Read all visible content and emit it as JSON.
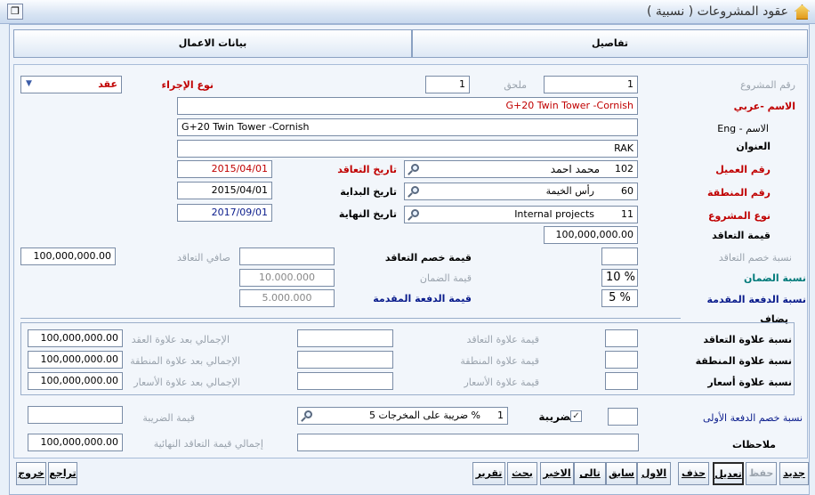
{
  "window": {
    "title": "عقود المشروعات ( نسبية )",
    "app_icon": "home-icon",
    "restore_icon": "restore-icon"
  },
  "tabs": [
    "تفاصيل",
    "بيانات الاعمال"
  ],
  "labels": {
    "project_no": "رقم المشروع",
    "annex": "ملحق",
    "procedure_type": "نوع الإجراء",
    "name_ar": "الاسم -عربي",
    "name_en": "الاسم - Eng",
    "address": "العنوان",
    "client_no": "رقم العميل",
    "contract_date": "تاريخ التعاقد",
    "region_no": "رقم المنطقة",
    "start_date": "تاريخ البداية",
    "project_type": "نوع المشروع",
    "end_date": "تاريخ النهاية",
    "contract_value": "قيمة التعاقد",
    "discount_pct": "نسبة خصم التعاقد",
    "discount_value": "قيمة خصم التعاقد",
    "net_contract": "صافي التعاقد",
    "guarantee_pct": "نسبة الضمان",
    "guarantee_value": "قيمة الضمان",
    "advance_pct": "نسبة الدفعة المقدمة",
    "advance_value": "قيمة الدفعة المقدمة",
    "added": "يضاف",
    "contract_bonus_pct": "نسبة علاوة التعاقد",
    "contract_bonus_value": "قيمة علاوة التعاقد",
    "total_after_contract_bonus": "الإجمالي بعد علاوة العقد",
    "region_bonus_pct": "نسبة علاوة المنطقة",
    "region_bonus_value": "قيمة علاوة المنطقة",
    "total_after_region_bonus": "الإجمالي بعد علاوة المنطقة",
    "price_bonus_pct": "نسبة علاوة أسعار",
    "price_bonus_value": "قيمة علاوة الأسعار",
    "total_after_price_bonus": "الإجمالي بعد علاوة الأسعار",
    "first_advance_pct": "نسبة خصم الدفعة الأولى",
    "tax": "الضريبة",
    "tax_value": "قيمة الضريبة",
    "notes": "ملاحظات",
    "final_total": "إجمالي قيمة التعاقد النهائية"
  },
  "fields": {
    "project_no": "1",
    "annex": "1",
    "procedure_type": "عقد",
    "name_ar": "G+20 Twin Tower -Cornish",
    "name_en": "G+20 Twin Tower -Cornish",
    "address": "RAK",
    "client_code": "102",
    "client_name": "محمد احمد",
    "contract_date": "2015/04/01",
    "region_code": "60",
    "region_name": "رأس الخيمة",
    "start_date": "2015/04/01",
    "project_type_code": "11",
    "project_type_name": "Internal projects",
    "end_date": "2017/09/01",
    "contract_value": "100,000,000.00",
    "discount_pct": "",
    "discount_value": "",
    "net_contract": "100,000,000.00",
    "guarantee_pct": "10 %",
    "guarantee_value": "10.000.000",
    "advance_pct": "5 %",
    "advance_value": "5.000.000",
    "contract_bonus_pct": "",
    "contract_bonus_value": "",
    "total_after_contract_bonus": "100,000,000.00",
    "region_bonus_pct": "",
    "region_bonus_value": "",
    "total_after_region_bonus": "100,000,000.00",
    "price_bonus_pct": "",
    "price_bonus_value": "",
    "total_after_price_bonus": "100,000,000.00",
    "first_advance_pct": "",
    "tax_checked": true,
    "tax_code": "1",
    "tax_name": "% ضريبة على المخرجات 5",
    "tax_value": "",
    "notes": "",
    "final_total": "100,000,000.00"
  },
  "buttons": {
    "new": "جديد",
    "save": "حفظ",
    "edit": "تعديل",
    "delete": "حذف",
    "first": "الاول",
    "previous": "سابق",
    "next": "تالى",
    "last": "الاخير",
    "search": "بحث",
    "report": "تقرير",
    "undo": "تراجع",
    "exit": "خروج"
  }
}
